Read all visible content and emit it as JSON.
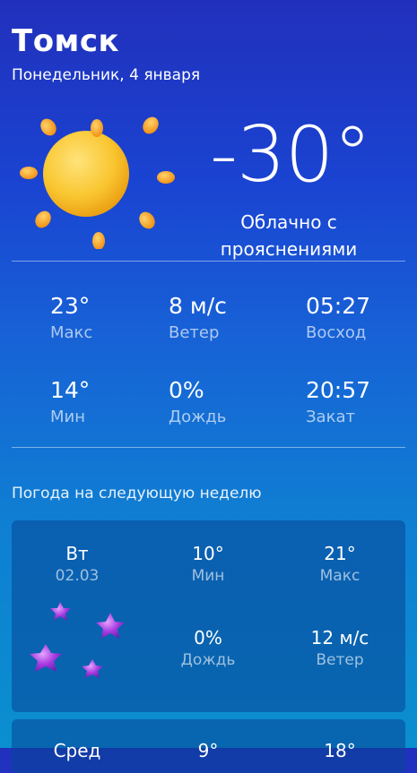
{
  "header": {
    "city": "Томск",
    "date": "Понедельник, 4 января"
  },
  "current": {
    "temperature": "-30°",
    "condition_line1": "Облачно с",
    "condition_line2": "прояснениями",
    "icon": "sun-icon"
  },
  "stats": {
    "max": {
      "value": "23°",
      "label": "Макс"
    },
    "wind": {
      "value": "8 м/с",
      "label": "Ветер"
    },
    "sunrise": {
      "value": "05:27",
      "label": "Восход"
    },
    "min": {
      "value": "14°",
      "label": "Мин"
    },
    "rain": {
      "value": "0%",
      "label": "Дождь"
    },
    "sunset": {
      "value": "20:57",
      "label": "Закат"
    }
  },
  "week": {
    "title": "Погода на следующую неделю",
    "days": [
      {
        "day": "Вт",
        "date": "02.03",
        "min_value": "10°",
        "min_label": "Мин",
        "max_value": "21°",
        "max_label": "Макс",
        "rain_value": "0%",
        "rain_label": "Дождь",
        "wind_value": "12 м/с",
        "wind_label": "Ветер",
        "icon": "purple-stars-icon"
      },
      {
        "day": "Сред",
        "min_value": "9°",
        "max_value": "18°"
      }
    ]
  },
  "colors": {
    "background_top": "#2130bc",
    "background_bottom": "#0a8fd0",
    "sun": "#f7c531",
    "stars": "#a63be0"
  }
}
